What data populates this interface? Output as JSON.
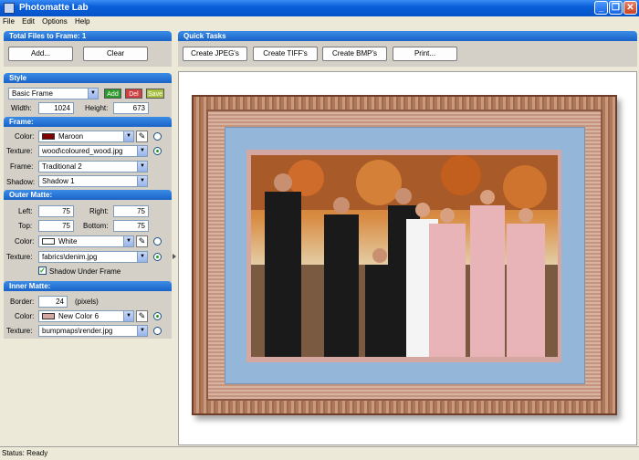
{
  "window": {
    "title": "Photomatte Lab"
  },
  "menu": [
    "File",
    "Edit",
    "Options",
    "Help"
  ],
  "files_panel": {
    "title": "Total Files to Frame: 1",
    "add_label": "Add...",
    "clear_label": "Clear"
  },
  "tasks_panel": {
    "title": "Quick Tasks",
    "buttons": [
      "Create JPEG's",
      "Create TIFF's",
      "Create BMP's",
      "Print..."
    ]
  },
  "style": {
    "title": "Style",
    "selected": "Basic Frame",
    "add_label": "Add",
    "del_label": "Del",
    "save_label": "Save",
    "width_label": "Width:",
    "width": "1024",
    "height_label": "Height:",
    "height": "673"
  },
  "frame": {
    "title": "Frame:",
    "color_label": "Color:",
    "color": "Maroon",
    "color_hex": "#800000",
    "texture_label": "Texture:",
    "texture": "wood\\coloured_wood.jpg",
    "frame_label": "Frame:",
    "frame": "Traditional 2",
    "shadow_label": "Shadow:",
    "shadow": "Shadow 1"
  },
  "outer_matte": {
    "title": "Outer Matte:",
    "left_label": "Left:",
    "left": "75",
    "right_label": "Right:",
    "right": "75",
    "top_label": "Top:",
    "top": "75",
    "bottom_label": "Bottom:",
    "bottom": "75",
    "color_label": "Color:",
    "color": "White",
    "color_hex": "#ffffff",
    "texture_label": "Texture:",
    "texture": "fabrics\\denim.jpg",
    "shadow_checkbox": "Shadow Under Frame"
  },
  "inner_matte": {
    "title": "Inner Matte:",
    "border_label": "Border:",
    "border": "24",
    "border_unit": "(pixels)",
    "color_label": "Color:",
    "color": "New Color 6",
    "color_hex": "#d4a8a0",
    "texture_label": "Texture:",
    "texture": "bumpmaps\\render.jpg"
  },
  "status": "Status: Ready",
  "colors": {
    "titlebar": "#0a5fd8",
    "panel_header": "#2a74d8",
    "add": "#2a9a2a",
    "del": "#d04040",
    "save": "#a8c040"
  }
}
